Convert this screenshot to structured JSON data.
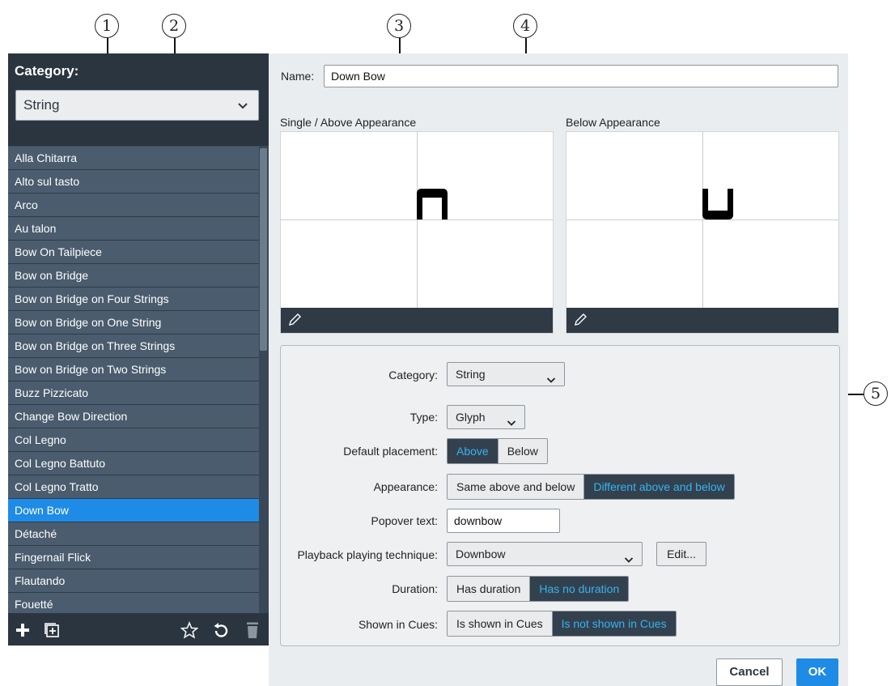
{
  "callouts": [
    "1",
    "2",
    "3",
    "4",
    "5"
  ],
  "sidebar": {
    "category_label": "Category:",
    "category_value": "String",
    "items": [
      "Alla Chitarra",
      "Alto sul tasto",
      "Arco",
      "Au talon",
      "Bow On Tailpiece",
      "Bow on Bridge",
      "Bow on Bridge on Four Strings",
      "Bow on Bridge on One String",
      "Bow on Bridge on Three Strings",
      "Bow on Bridge on Two Strings",
      "Buzz Pizzicato",
      "Change Bow Direction",
      "Col Legno",
      "Col Legno Battuto",
      "Col Legno Tratto",
      "Down Bow",
      "Détaché",
      "Fingernail Flick",
      "Flautando",
      "Fouetté"
    ],
    "selected": "Down Bow",
    "footer_icons": [
      "add-icon",
      "duplicate-icon",
      "star-icon",
      "revert-icon",
      "delete-icon"
    ]
  },
  "editor": {
    "name_label": "Name:",
    "name_value": "Down Bow",
    "single_above_label": "Single / Above Appearance",
    "below_label": "Below Appearance"
  },
  "properties": {
    "category_label": "Category:",
    "category_value": "String",
    "type_label": "Type:",
    "type_value": "Glyph",
    "placement_label": "Default placement:",
    "placement_options": [
      "Above",
      "Below"
    ],
    "placement_selected": "Above",
    "appearance_label": "Appearance:",
    "appearance_options": [
      "Same above and below",
      "Different above and below"
    ],
    "appearance_selected": "Different above and below",
    "popover_label": "Popover text:",
    "popover_value": "downbow",
    "playback_label": "Playback playing technique:",
    "playback_value": "Downbow",
    "edit_label": "Edit...",
    "duration_label": "Duration:",
    "duration_options": [
      "Has duration",
      "Has no duration"
    ],
    "duration_selected": "Has no duration",
    "cues_label": "Shown in Cues:",
    "cues_options": [
      "Is shown in Cues",
      "Is not shown in Cues"
    ],
    "cues_selected": "Is not shown in Cues"
  },
  "footer": {
    "cancel_label": "Cancel",
    "ok_label": "OK"
  },
  "colors": {
    "accent": "#1e8be6",
    "active_segment_text": "#36b3ef",
    "panel_dark": "#2b3540"
  }
}
